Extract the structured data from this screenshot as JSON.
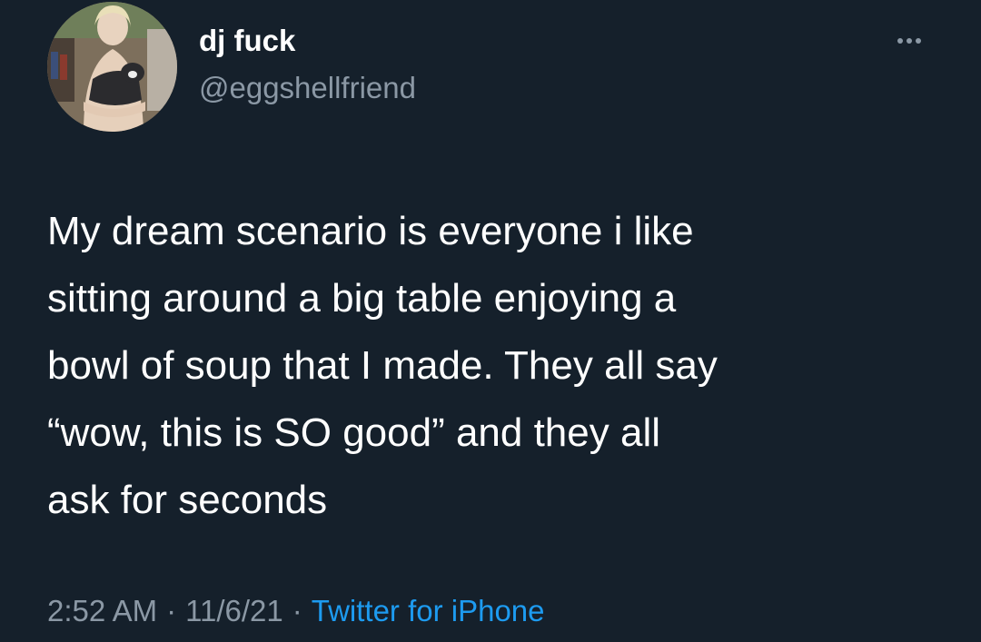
{
  "tweet": {
    "display_name": "dj fuck",
    "handle": "@eggshellfriend",
    "more_icon": "more-horizontal-icon",
    "text_lines": [
      "My dream scenario is everyone i like",
      "sitting around a big table enjoying a",
      "bowl of soup that I made. They all say",
      "“wow, this is SO good” and they all",
      "ask for seconds"
    ],
    "time": "2:52 AM",
    "date": "11/6/21",
    "separator": "·",
    "source": "Twitter for iPhone"
  },
  "colors": {
    "background": "#15202b",
    "primary_text": "#ffffff",
    "secondary_text": "#8b98a5",
    "link": "#1d9bf0"
  }
}
